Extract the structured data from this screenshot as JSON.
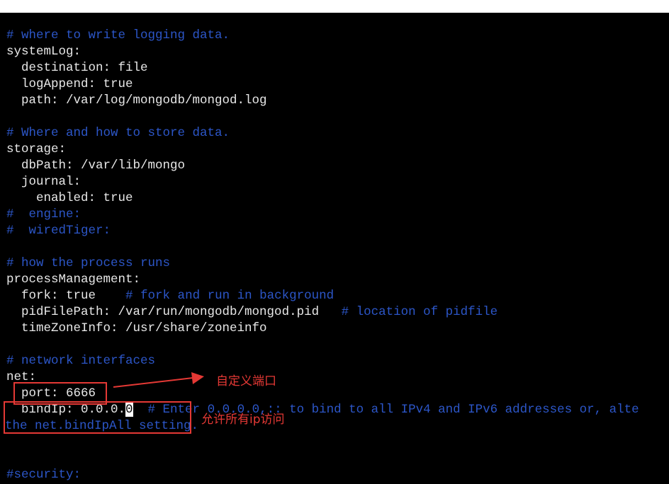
{
  "lines": [
    "# where to write logging data.",
    "systemLog:",
    "  destination: file",
    "  logAppend: true",
    "  path: /var/log/mongodb/mongod.log",
    "",
    "# Where and how to store data.",
    "storage:",
    "  dbPath: /var/lib/mongo",
    "  journal:",
    "    enabled: true",
    "#  engine:",
    "#  wiredTiger:",
    "",
    "# how the process runs",
    "processManagement:",
    "  fork: true",
    "  # fork and run in background",
    "  pidFilePath: /var/run/mongodb/mongod.pid",
    "  # location of pidfile",
    "  timeZoneInfo: /usr/share/zoneinfo",
    "",
    "# network interfaces",
    "net:",
    "  port: 6666",
    "  bindIp: 0.0.0.",
    "0",
    "  # Enter 0.0.0.0,:: to bind to all IPv4 and IPv6 addresses or, alte",
    "the net.bindIpAll setting.",
    "",
    "",
    "#security:"
  ],
  "annotations": {
    "port_note": "自定义端口",
    "bindip_note": "允许所有ip访问"
  },
  "colors": {
    "comment": "#2c56c8",
    "text": "#e8e8e8",
    "annotation": "#e53935",
    "background": "#000000"
  }
}
